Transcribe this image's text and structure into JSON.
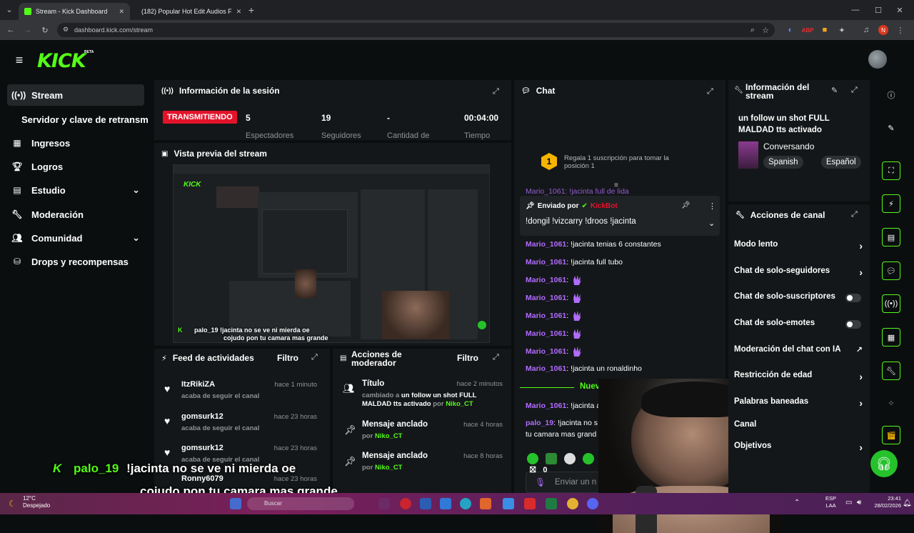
{
  "browser": {
    "tabs": [
      {
        "title": "Stream - Kick Dashboard",
        "active": true
      },
      {
        "title": "(182) Popular Hot Edit Audios F",
        "active": false
      }
    ],
    "new_tab": "+",
    "url": "dashboard.kick.com/stream",
    "profile_initial": "N",
    "window_min": "—",
    "window_max": "☐",
    "window_close": "✕"
  },
  "kick": {
    "logo": "KICK",
    "logo_badge": "BETA",
    "nav": [
      {
        "label": "Stream",
        "icon": "stream-icon",
        "active": true
      },
      {
        "label": "Servidor y clave de retransm",
        "icon": "",
        "active": false
      },
      {
        "label": "Ingresos",
        "icon": "revenue-icon"
      },
      {
        "label": "Logros",
        "icon": "trophy-icon"
      },
      {
        "label": "Estudio",
        "icon": "studio-icon",
        "chevron": true
      },
      {
        "label": "Moderación",
        "icon": "wrench-icon"
      },
      {
        "label": "Comunidad",
        "icon": "community-icon",
        "chevron": true
      },
      {
        "label": "Drops y recompensas",
        "icon": "drops-icon"
      }
    ]
  },
  "session": {
    "title": "Información de la sesión",
    "status_badge": "TRANSMITIENDO",
    "stats": [
      {
        "value": "5",
        "label": "Espectadores"
      },
      {
        "value": "19",
        "label": "Seguidores"
      },
      {
        "value": "-",
        "label": "Cantidad de"
      },
      {
        "value": "00:04:00",
        "label": "Tiempo"
      }
    ]
  },
  "preview": {
    "title": "Vista previa del stream"
  },
  "feed": {
    "title": "Feed de actividades",
    "filter": "Filtro",
    "items": [
      {
        "user": "ItzRikiZA",
        "action": "acaba de seguir el canal",
        "time": "hace 1 minuto"
      },
      {
        "user": "gomsurk12",
        "action": "acaba de seguir el canal",
        "time": "hace 23 horas"
      },
      {
        "user": "gomsurk12",
        "action": "acaba de seguir el canal",
        "time": "hace 23 horas"
      },
      {
        "user": "Ronny6079",
        "action": "",
        "time": "hace 23 horas"
      }
    ]
  },
  "modactions": {
    "title_line1": "Acciones de",
    "title_line2": "moderador",
    "filter": "Filtro",
    "items": [
      {
        "title": "Título",
        "time": "hace 2 minutos",
        "detail_a": "cambiado a ",
        "detail_b": "un follow un shot FULL MALDAD tts activado",
        "detail_c": " por ",
        "by": "Niko_CT"
      },
      {
        "title": "Mensaje anclado",
        "time": "hace 4 horas",
        "detail_c": "por ",
        "by": "Niko_CT"
      },
      {
        "title": "Mensaje anclado",
        "time": "hace 8 horas",
        "detail_c": "por ",
        "by": "Niko_CT"
      }
    ]
  },
  "chat": {
    "title": "Chat",
    "gift_prompt": "Regala 1 suscripción para tomar la posición 1",
    "gift_number": "1",
    "cut_line": "Mario_1061: !jacinta full de lida",
    "pinned_sent_by": "Enviado por",
    "pinned_bot": "KickBot",
    "pinned_text": "!dongil !vizcarry !droos !jacinta",
    "messages": [
      {
        "user": "Mario_1061",
        "text": "!jacinta tenias 6 constantes"
      },
      {
        "user": "Mario_1061",
        "text": "!jacinta full tubo"
      },
      {
        "user": "Mario_1061",
        "text": "",
        "emote": true
      },
      {
        "user": "Mario_1061",
        "text": "",
        "emote": true
      },
      {
        "user": "Mario_1061",
        "text": "",
        "emote": true
      },
      {
        "user": "Mario_1061",
        "text": "",
        "emote": true
      },
      {
        "user": "Mario_1061",
        "text": "",
        "emote": true
      },
      {
        "user": "Mario_1061",
        "text": "!jacinta un ronaldinho"
      }
    ],
    "new_messages": "Nuevos mensajes",
    "after": [
      {
        "user": "Mario_1061",
        "text": "!jacinta a que hora el shot mierda",
        "color": "#b16cff"
      },
      {
        "user": "palo_19",
        "text": "!jacinta no s",
        "color": "#b16cff"
      }
    ],
    "after_cont": "tu camara mas grand",
    "input_placeholder": "Enviar un n",
    "points": "0"
  },
  "streaminfo": {
    "title_line1": "Información del",
    "title_line2": "stream",
    "stream_title": "un follow un shot FULL MALDAD tts activado",
    "category": "Conversando",
    "tags": [
      "Spanish",
      "Español"
    ]
  },
  "channel_actions": {
    "title": "Acciones de canal",
    "items": [
      {
        "label": "Modo lento",
        "control": "chevron"
      },
      {
        "label": "Chat de solo-seguidores",
        "control": "chevron"
      },
      {
        "label": "Chat de solo-suscriptores",
        "control": "toggle"
      },
      {
        "label": "Chat de solo-emotes",
        "control": "toggle"
      },
      {
        "label": "Moderación del chat con IA",
        "control": "external"
      },
      {
        "label": "Restricción de edad",
        "control": "chevron"
      },
      {
        "label": "Palabras baneadas",
        "control": "chevron"
      },
      {
        "label": "Canal",
        "control": ""
      },
      {
        "label": "Objetivos",
        "control": "chevron"
      }
    ]
  },
  "overlay": {
    "user": "palo_19",
    "line1": "!jacinta no se ve ni mierda oe",
    "line2": "cojudo pon tu camara mas grande"
  },
  "taskbar": {
    "temp": "12°C",
    "weather": "Despejado",
    "search": "Buscar",
    "lang1": "ESP",
    "lang2": "LAA",
    "time": "23:41",
    "date": "28/02/2026"
  },
  "colors": {
    "accent": "#53fc18",
    "username": "#b16cff",
    "live": "#e3132a"
  }
}
